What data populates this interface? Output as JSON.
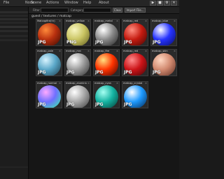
{
  "menu": [
    "File",
    "Node",
    "Scene",
    "Actions",
    "Window",
    "Help",
    "About"
  ],
  "toolbar_icons": [
    "play-icon",
    "stop-icon",
    "settings-icon",
    "close-icon"
  ],
  "browser": {
    "filter_label": "Filter",
    "category_label": "Category",
    "clear_label": "Clear",
    "import_label": "Import File...",
    "path": "guest / textures / matcap"
  },
  "tiles": [
    {
      "name": "Matcapfire(hr)",
      "format": "JPG",
      "colors": [
        "#ff8a3a",
        "#b8300f",
        "#3a0800"
      ]
    },
    {
      "name": "matcap_yellow",
      "format": "PNG",
      "colors": [
        "#f8f6c0",
        "#c9c462",
        "#5b561a"
      ]
    },
    {
      "name": "matcap_metal",
      "format": "JPG",
      "colors": [
        "#ffffff",
        "#8a8a8a",
        "#1f1f1f"
      ]
    },
    {
      "name": "matcap_red",
      "format": "JPG",
      "colors": [
        "#ff8e80",
        "#c51b10",
        "#3e0503"
      ]
    },
    {
      "name": "matcap_blue",
      "format": "JPG",
      "colors": [
        "#ffffff",
        "#2633ff",
        "#050a60"
      ]
    },
    {
      "name": "matcap_pale",
      "format": "JPG",
      "colors": [
        "#d8f4ff",
        "#5aa7c8",
        "#1c3a48"
      ]
    },
    {
      "name": "matcap_mrc",
      "format": "JPG",
      "colors": [
        "#ffffff",
        "#9a9a9a",
        "#2a2a2a"
      ]
    },
    {
      "name": "matcap_fire",
      "format": "JPG",
      "colors": [
        "#ffe080",
        "#ff3300",
        "#3a0300"
      ]
    },
    {
      "name": "matcap_red",
      "format": "JPG",
      "colors": [
        "#ff8c8c",
        "#cc1418",
        "#3c0305"
      ]
    },
    {
      "name": "matcap_skin",
      "format": "JPG",
      "colors": [
        "#ffd8c2",
        "#d28a70",
        "#5a2a1e"
      ]
    },
    {
      "name": "matcap_normal",
      "format": "JPG",
      "colors": [
        "#ffaaff",
        "#6f6fff",
        "#30ffa0"
      ]
    },
    {
      "name": "matcap_aluminium",
      "format": "JPG",
      "colors": [
        "#ffffff",
        "#a8a8a8",
        "#3a3a3a"
      ]
    },
    {
      "name": "matcap_cyan",
      "format": "JPG",
      "colors": [
        "#a6fff2",
        "#15b3a2",
        "#023a33"
      ]
    },
    {
      "name": "matcap_crystal",
      "format": "JPG",
      "colors": [
        "#ffffff",
        "#1e9aff",
        "#02254f"
      ]
    }
  ]
}
